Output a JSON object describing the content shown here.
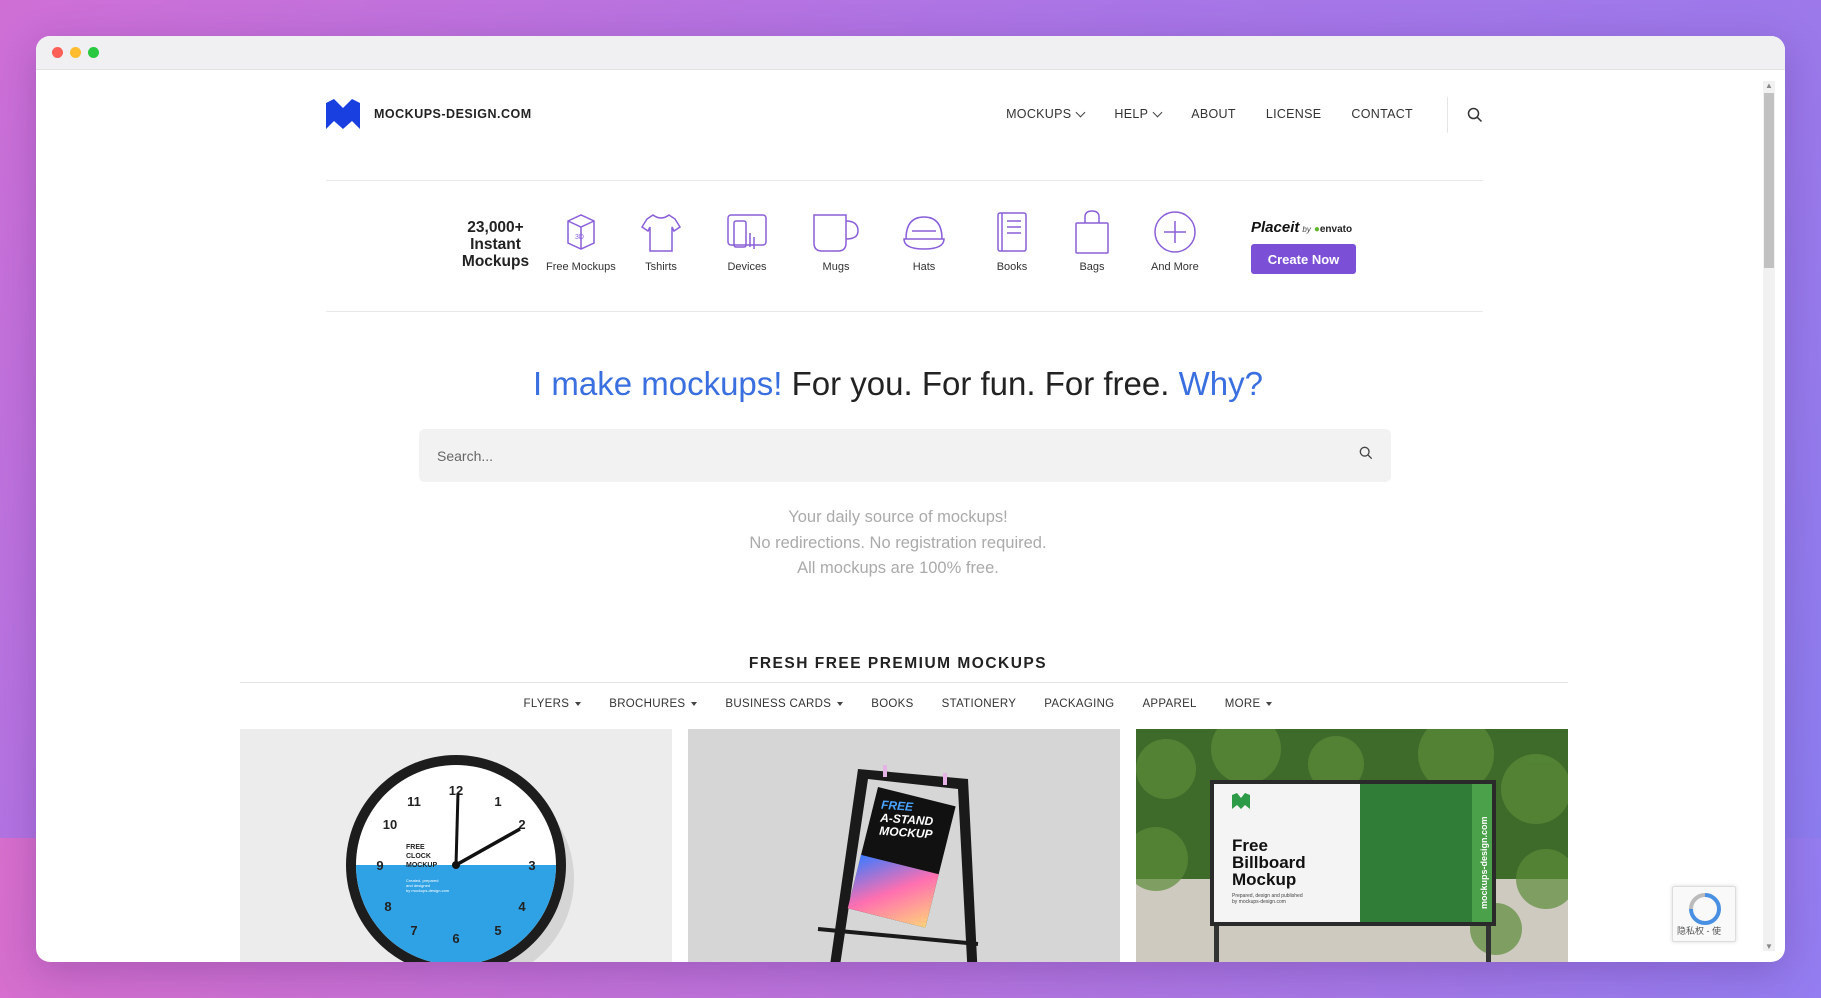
{
  "window": {
    "dots": [
      "#ff5f57",
      "#febc2e",
      "#28c840"
    ]
  },
  "header": {
    "logo_text": "MOCKUPS-DESIGN.COM",
    "nav": [
      {
        "label": "MOCKUPS",
        "dropdown": true
      },
      {
        "label": "HELP",
        "dropdown": true
      },
      {
        "label": "ABOUT",
        "dropdown": false
      },
      {
        "label": "LICENSE",
        "dropdown": false
      },
      {
        "label": "CONTACT",
        "dropdown": false
      }
    ]
  },
  "catbar": {
    "title": "23,000+ Instant Mockups",
    "items": [
      {
        "label": "Free Mockups",
        "icon": "3d-box-icon"
      },
      {
        "label": "Tshirts",
        "icon": "tshirt-icon"
      },
      {
        "label": "Devices",
        "icon": "devices-icon"
      },
      {
        "label": "Mugs",
        "icon": "mug-icon"
      },
      {
        "label": "Hats",
        "icon": "hat-icon"
      },
      {
        "label": "Books",
        "icon": "book-icon"
      },
      {
        "label": "Bags",
        "icon": "bag-icon"
      },
      {
        "label": "And More",
        "icon": "plus-circle-icon"
      }
    ],
    "placeit_brand": "Placeit",
    "placeit_by": "by",
    "placeit_envato": "envato",
    "create_label": "Create Now",
    "accent": "#7b4fd6",
    "icon_color": "#8a5fd9"
  },
  "hero": {
    "part1": "I make mockups!",
    "part2": " For you. For fun. For free. ",
    "part3": "Why?",
    "blue": "#3a6fe0"
  },
  "search": {
    "placeholder": "Search..."
  },
  "tagline": {
    "line1": "Your daily source of mockups!",
    "line2": "No redirections. No registration required.",
    "line3": "All mockups are 100% free."
  },
  "fresh": {
    "title": "FRESH FREE PREMIUM MOCKUPS",
    "filters": [
      {
        "label": "FLYERS",
        "dropdown": true
      },
      {
        "label": "BROCHURES",
        "dropdown": true
      },
      {
        "label": "BUSINESS CARDS",
        "dropdown": true
      },
      {
        "label": "BOOKS",
        "dropdown": false
      },
      {
        "label": "STATIONERY",
        "dropdown": false
      },
      {
        "label": "PACKAGING",
        "dropdown": false
      },
      {
        "label": "APPAREL",
        "dropdown": false
      },
      {
        "label": "MORE",
        "dropdown": true
      }
    ]
  },
  "cards": {
    "clock": {
      "l1": "FREE",
      "l2": "CLOCK",
      "l3": "MOCKUP",
      "sub1": "Created, prepared",
      "sub2": "and designed",
      "sub3": "by mockups-design.com",
      "numbers": [
        "12",
        "1",
        "2",
        "3",
        "4",
        "5",
        "6",
        "7",
        "8",
        "9",
        "10",
        "11"
      ]
    },
    "astand": {
      "l1": "FREE",
      "l2": "A-STAND",
      "l3": "MOCKUP"
    },
    "billboard": {
      "l1": "Free",
      "l2": "Billboard",
      "l3": "Mockup",
      "sub1": "Prepared, design and published",
      "sub2": "by mockups-design.com",
      "side": "mockups-design.com"
    }
  },
  "recaptcha": {
    "text": "隐私权 - 使"
  }
}
